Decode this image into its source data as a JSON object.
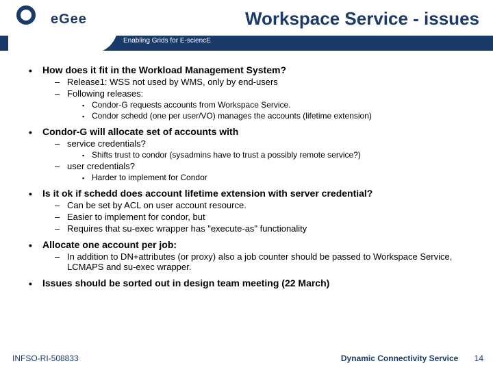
{
  "header": {
    "title": "Workspace Service - issues",
    "tagline": "Enabling Grids for E-sciencE"
  },
  "logo": {
    "text": "eGee"
  },
  "content": {
    "b1": {
      "text": "How does it fit in the Workload Management System?",
      "s1": "Release1: WSS not used by WMS, only by end-users",
      "s2": "Following releases:",
      "s2a": "Condor-G requests accounts from Workspace Service.",
      "s2b": "Condor schedd (one per user/VO) manages the accounts (lifetime extension)"
    },
    "b2": {
      "text": "Condor-G will allocate set of accounts with",
      "s1": "service credentials?",
      "s1a": "Shifts trust to condor (sysadmins have to trust a possibly remote service?)",
      "s2": "user credentials?",
      "s2a": "Harder to implement for Condor"
    },
    "b3": {
      "text": "Is it ok if schedd does account lifetime extension with server credential?",
      "s1": "Can be set by ACL on user account resource.",
      "s2": "Easier to implement for condor, but",
      "s3": "Requires that su-exec wrapper has \"execute-as\" functionality"
    },
    "b4": {
      "text": "Allocate one account per job:",
      "s1": "In addition to DN+attributes (or proxy) also a job counter should be passed to Workspace Service, LCMAPS and su-exec wrapper."
    },
    "b5": {
      "text": "Issues should be sorted out in design team meeting (22 March)"
    }
  },
  "footer": {
    "left": "INFSO-RI-508833",
    "right": "Dynamic Connectivity Service",
    "page": "14"
  }
}
